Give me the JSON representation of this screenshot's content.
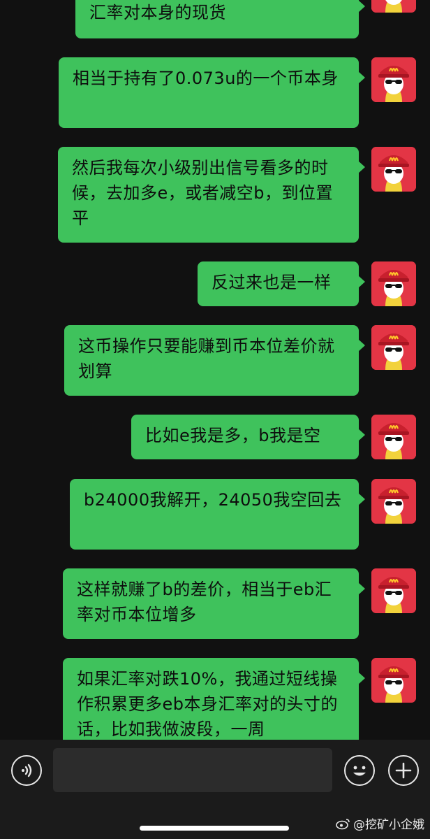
{
  "messages": [
    {
      "text": "汇率对本身的现货"
    },
    {
      "text": "相当于持有了0.073u的一个币本身"
    },
    {
      "text": "然后我每次小级别出信号看多的时候，去加多e，或者减空b，到位置平"
    },
    {
      "text": "反过来也是一样"
    },
    {
      "text": "这币操作只要能赚到币本位差价就划算"
    },
    {
      "text": "比如e我是多，b我是空"
    },
    {
      "text": "b24000我解开，24050我空回去"
    },
    {
      "text": "这样就赚了b的差价，相当于eb汇率对币本位增多"
    },
    {
      "text": "如果汇率对跌10%，我通过短线操作积累更多eb本身汇率对的头寸的话，比如我做波段，一周"
    }
  ],
  "input": {
    "placeholder": ""
  },
  "watermark": {
    "text": "@挖矿小企娥"
  },
  "colors": {
    "bubble": "#3fc25c",
    "background": "#111111",
    "avatar_bg": "#e33545",
    "logo": "#ffc72c"
  },
  "icons": [
    "voice-icon",
    "emoji-icon",
    "plus-icon",
    "weibo-icon"
  ]
}
